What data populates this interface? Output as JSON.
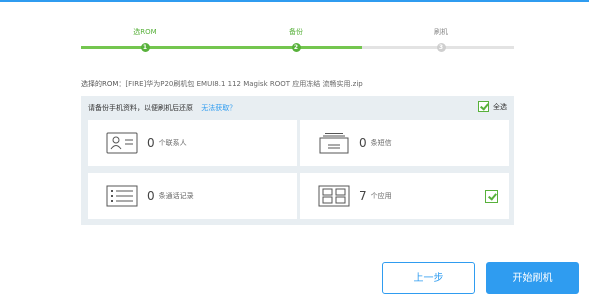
{
  "colors": {
    "accent": "#2f9cf0",
    "success": "#58b13b",
    "panel_bg": "#e8eef2"
  },
  "steps": [
    {
      "label": "选ROM",
      "number": "1",
      "state": "done"
    },
    {
      "label": "备份",
      "number": "2",
      "state": "active"
    },
    {
      "label": "刷机",
      "number": "3",
      "state": "pending"
    }
  ],
  "rom": {
    "label": "选择的ROM：",
    "value": "[FIRE]华为P20刷机包 EMUI8.1 112 Magisk ROOT 应用冻结 流畅实用.zip"
  },
  "backup": {
    "title": "请备份手机资料，以便刷机后还原",
    "help_link": "无法获取？",
    "select_all_label": "全选",
    "items": [
      {
        "count": "0",
        "label": "个联系人",
        "icon": "contact-card-icon",
        "checked": false
      },
      {
        "count": "0",
        "label": "条短信",
        "icon": "message-stack-icon",
        "checked": false
      },
      {
        "count": "0",
        "label": "条通话记录",
        "icon": "call-list-icon",
        "checked": false
      },
      {
        "count": "7",
        "label": "个应用",
        "icon": "apps-grid-icon",
        "checked": true
      }
    ]
  },
  "buttons": {
    "prev": "上一步",
    "start": "开始刷机"
  }
}
